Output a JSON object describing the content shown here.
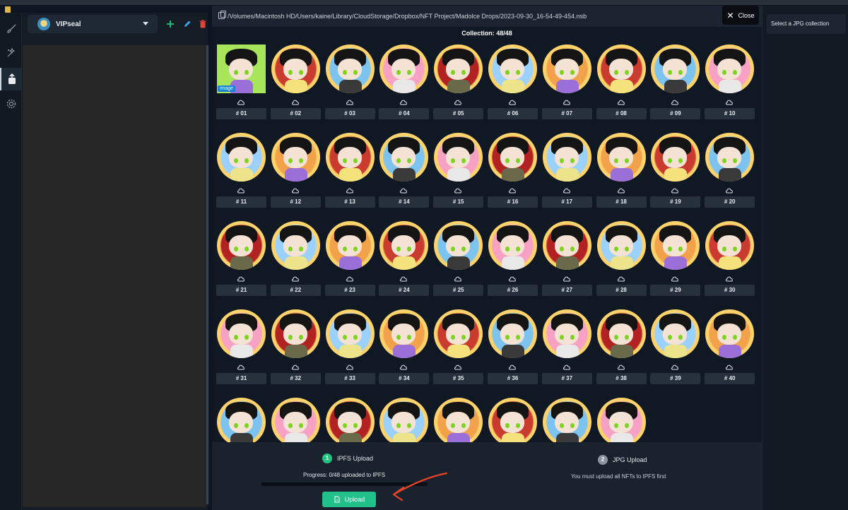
{
  "app": {
    "selector_name": "VIPseal"
  },
  "dialog": {
    "path": "/Volumes/Macintosh HD/Users/kaine/Library/CloudStorage/Dropbox/NFT Project/Madolce Drops/2023-09-30_16-54-49-454.nsb",
    "close_label": "Close",
    "collection_label": "Collection: 48/48",
    "first_item_badge": "image",
    "items": [
      "# 01",
      "# 02",
      "# 03",
      "# 04",
      "# 05",
      "# 06",
      "# 07",
      "# 08",
      "# 09",
      "# 10",
      "# 11",
      "# 12",
      "# 13",
      "# 14",
      "# 15",
      "# 16",
      "# 17",
      "# 18",
      "# 19",
      "# 20",
      "# 21",
      "# 22",
      "# 23",
      "# 24",
      "# 25",
      "# 26",
      "# 27",
      "# 28",
      "# 29",
      "# 30",
      "# 31",
      "# 32",
      "# 33",
      "# 34",
      "# 35",
      "# 36",
      "# 37",
      "# 38",
      "# 39",
      "# 40",
      "",
      "",
      "",
      "",
      "",
      "",
      "",
      ""
    ],
    "step1": {
      "number": "1",
      "label": "IPFS Upload",
      "progress_text": "Progress: 0/48 uploaded to IPFS",
      "progress_fraction": 0,
      "button_label": "Upload"
    },
    "step2": {
      "number": "2",
      "label": "JPG Upload",
      "note": "You must upload all NFTs to IPFS first"
    }
  },
  "right_panel": {
    "select_label": "Select a JPG collection"
  },
  "colors": {
    "accent_green": "#26c281",
    "delete_red": "#e0453a",
    "edit_blue": "#3ea6f0",
    "annotation_red": "#e8442a"
  },
  "icons": [
    "brush-icon",
    "magic-icon",
    "upload-icon",
    "gear-icon",
    "plus-icon",
    "pencil-icon",
    "trash-icon",
    "copy-icon",
    "close-icon",
    "cloud-icon",
    "file-icon"
  ]
}
